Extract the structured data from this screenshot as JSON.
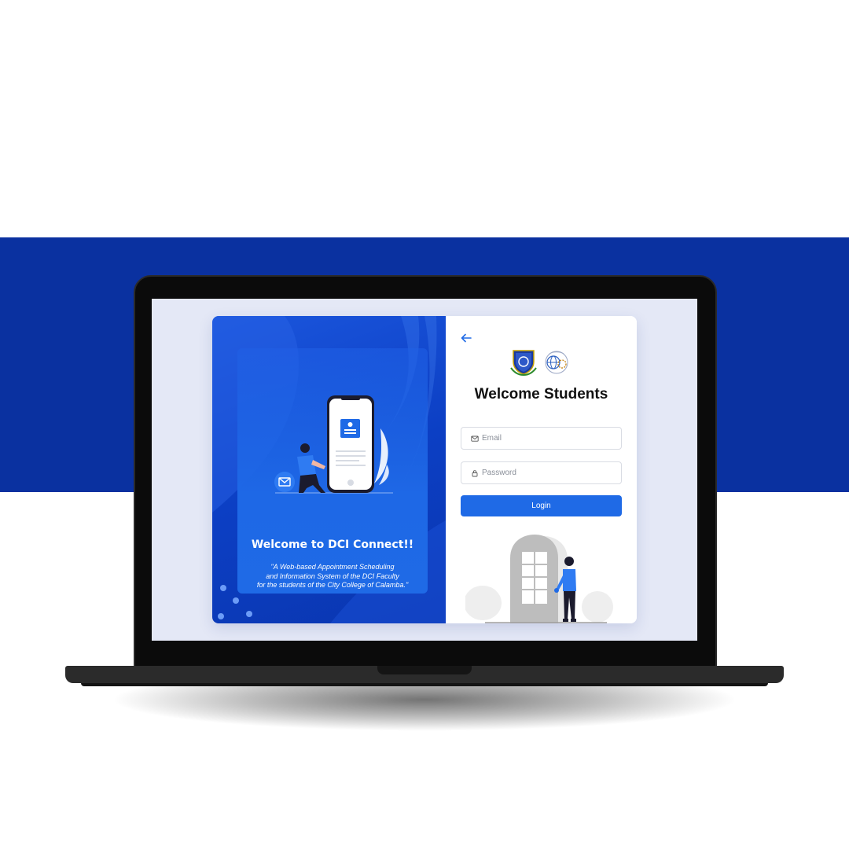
{
  "colors": {
    "brand_blue": "#0a31a0",
    "primary": "#1f6ae6",
    "screen_bg": "#e4e8f6"
  },
  "left_panel": {
    "title": "Welcome to DCI Connect!!",
    "tagline": [
      "\"A Web-based Appointment Scheduling",
      "and Information System of the DCI Faculty",
      "for the students of the City College of Calamba.\""
    ],
    "illustration": "person-with-phone-illustration"
  },
  "login": {
    "back_icon": "arrow-left-icon",
    "logos": [
      "city-college-crest-logo",
      "dci-globe-logo"
    ],
    "title": "Welcome Students",
    "email": {
      "icon": "mail-icon",
      "placeholder": "Email",
      "value": ""
    },
    "password": {
      "icon": "lock-icon",
      "placeholder": "Password",
      "value": ""
    },
    "login_label": "Login",
    "illustration": "person-at-door-illustration"
  }
}
